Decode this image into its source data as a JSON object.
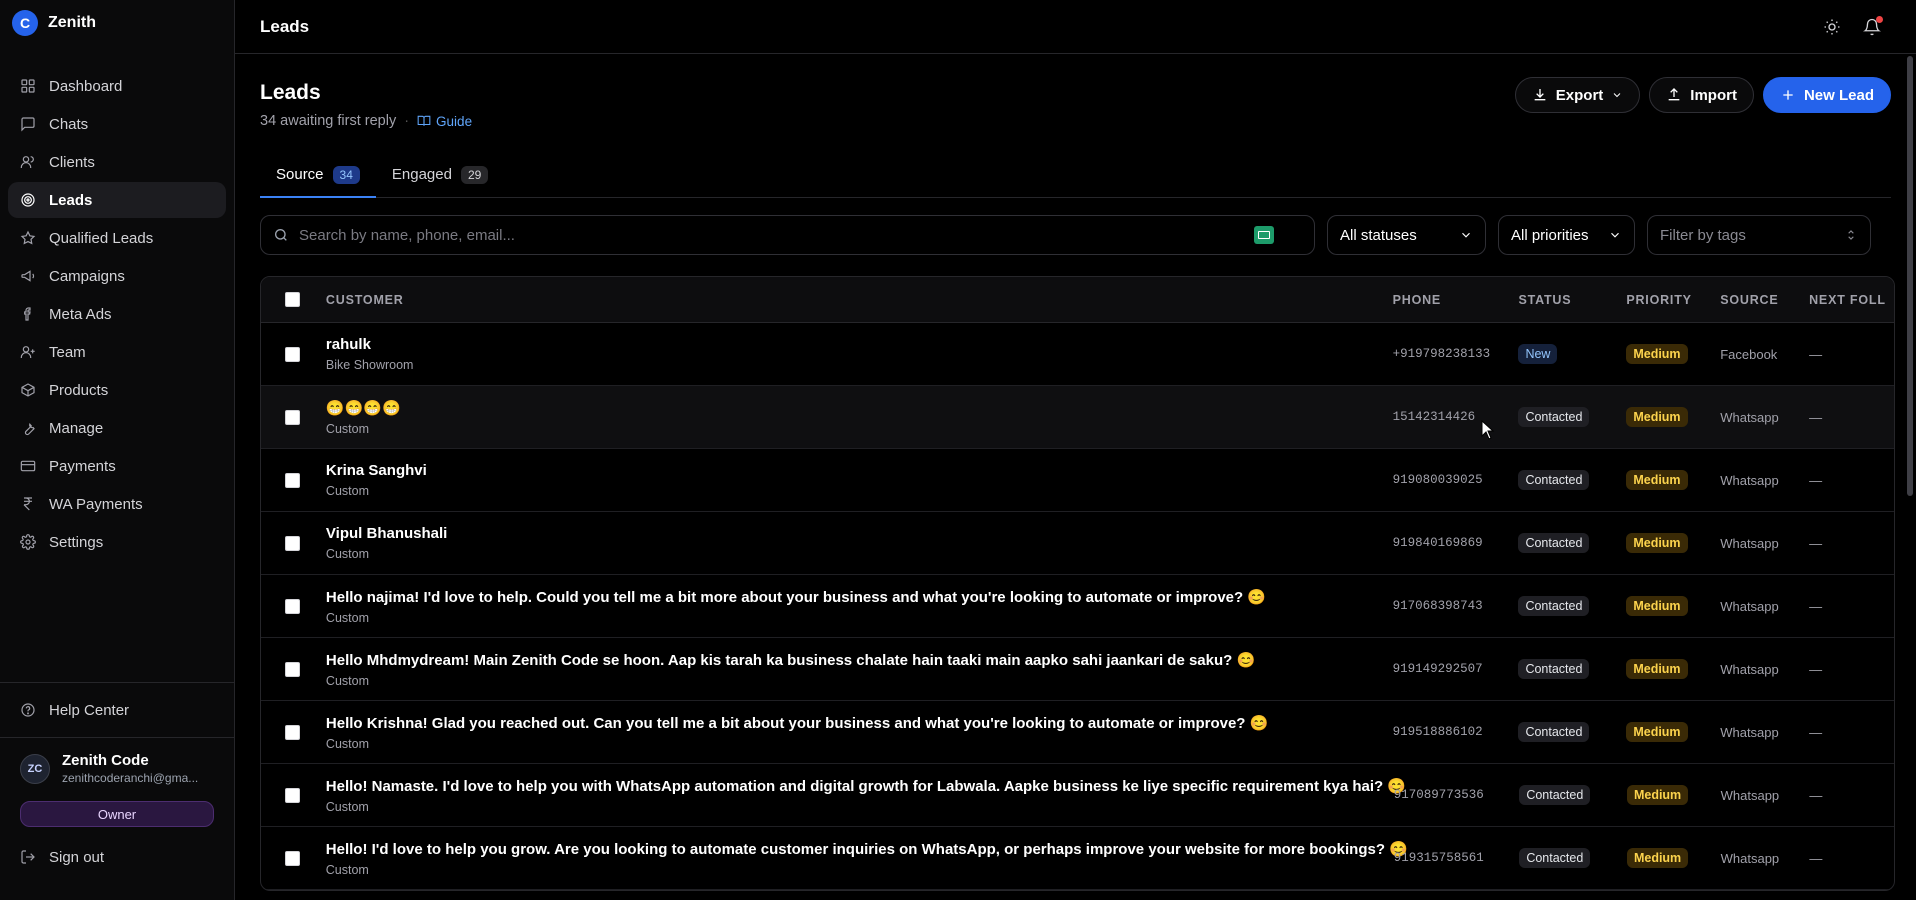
{
  "brand": {
    "initial": "C",
    "name": "Zenith",
    "accent": "#2563eb"
  },
  "nav": [
    {
      "label": "Dashboard",
      "icon": "grid-icon",
      "active": false
    },
    {
      "label": "Chats",
      "icon": "chat-icon",
      "active": false
    },
    {
      "label": "Clients",
      "icon": "users-icon",
      "active": false
    },
    {
      "label": "Leads",
      "icon": "target-icon",
      "active": true
    },
    {
      "label": "Qualified Leads",
      "icon": "star-icon",
      "active": false
    },
    {
      "label": "Campaigns",
      "icon": "megaphone-icon",
      "active": false
    },
    {
      "label": "Meta Ads",
      "icon": "facebook-icon",
      "active": false
    },
    {
      "label": "Team",
      "icon": "team-icon",
      "active": false
    },
    {
      "label": "Products",
      "icon": "package-icon",
      "active": false
    },
    {
      "label": "Manage",
      "icon": "wrench-icon",
      "active": false
    },
    {
      "label": "Payments",
      "icon": "card-icon",
      "active": false
    },
    {
      "label": "WA Payments",
      "icon": "rupee-icon",
      "active": false
    },
    {
      "label": "Settings",
      "icon": "gear-icon",
      "active": false
    }
  ],
  "help_center": "Help Center",
  "user": {
    "initials": "ZC",
    "name": "Zenith Code",
    "email": "zenithcoderanchi@gma...",
    "role": "Owner"
  },
  "sign_out": "Sign out",
  "topbar": {
    "title": "Leads"
  },
  "page": {
    "title": "Leads",
    "subtitle": "34 awaiting first reply",
    "guide": "Guide",
    "export": "Export",
    "import": "Import",
    "new_lead": "New Lead"
  },
  "tabs": [
    {
      "label": "Source",
      "count": "34",
      "active": true
    },
    {
      "label": "Engaged",
      "count": "29",
      "active": false
    }
  ],
  "filters": {
    "search_placeholder": "Search by name, phone, email...",
    "status": "All statuses",
    "priority": "All priorities",
    "tags": "Filter by tags"
  },
  "table": {
    "headers": {
      "customer": "CUSTOMER",
      "phone": "PHONE",
      "status": "STATUS",
      "priority": "PRIORITY",
      "source": "SOURCE",
      "next": "NEXT FOLL"
    },
    "rows": [
      {
        "name": "rahulk",
        "sub": "Bike Showroom",
        "phone": "+919798238133",
        "status": "New",
        "priority": "Medium",
        "source": "Facebook",
        "next": "—"
      },
      {
        "name": "😁😁😁😁",
        "sub": "Custom",
        "phone": "15142314426",
        "status": "Contacted",
        "priority": "Medium",
        "source": "Whatsapp",
        "next": "—"
      },
      {
        "name": "Krina Sanghvi",
        "sub": "Custom",
        "phone": "919080039025",
        "status": "Contacted",
        "priority": "Medium",
        "source": "Whatsapp",
        "next": "—"
      },
      {
        "name": "Vipul Bhanushali",
        "sub": "Custom",
        "phone": "919840169869",
        "status": "Contacted",
        "priority": "Medium",
        "source": "Whatsapp",
        "next": "—"
      },
      {
        "name": "Hello najima! I'd love to help. Could you tell me a bit more about your business and what you're looking to automate or improve? 😊",
        "sub": "Custom",
        "phone": "917068398743",
        "status": "Contacted",
        "priority": "Medium",
        "source": "Whatsapp",
        "next": "—"
      },
      {
        "name": "Hello Mhdmydream! Main Zenith Code se hoon. Aap kis tarah ka business chalate hain taaki main aapko sahi jaankari de saku? 😊",
        "sub": "Custom",
        "phone": "919149292507",
        "status": "Contacted",
        "priority": "Medium",
        "source": "Whatsapp",
        "next": "—"
      },
      {
        "name": "Hello Krishna! Glad you reached out. Can you tell me a bit about your business and what you're looking to automate or improve? 😊",
        "sub": "Custom",
        "phone": "919518886102",
        "status": "Contacted",
        "priority": "Medium",
        "source": "Whatsapp",
        "next": "—"
      },
      {
        "name": "Hello! Namaste. I'd love to help you with WhatsApp automation and digital growth for Labwala. Aapke business ke liye specific requirement kya hai? 😊",
        "sub": "Custom",
        "phone": "917089773536",
        "status": "Contacted",
        "priority": "Medium",
        "source": "Whatsapp",
        "next": "—"
      },
      {
        "name": "Hello! I'd love to help you grow. Are you looking to automate customer inquiries on WhatsApp, or perhaps improve your website for more bookings? 😊",
        "sub": "Custom",
        "phone": "919315758561",
        "status": "Contacted",
        "priority": "Medium",
        "source": "Whatsapp",
        "next": "—"
      }
    ]
  }
}
